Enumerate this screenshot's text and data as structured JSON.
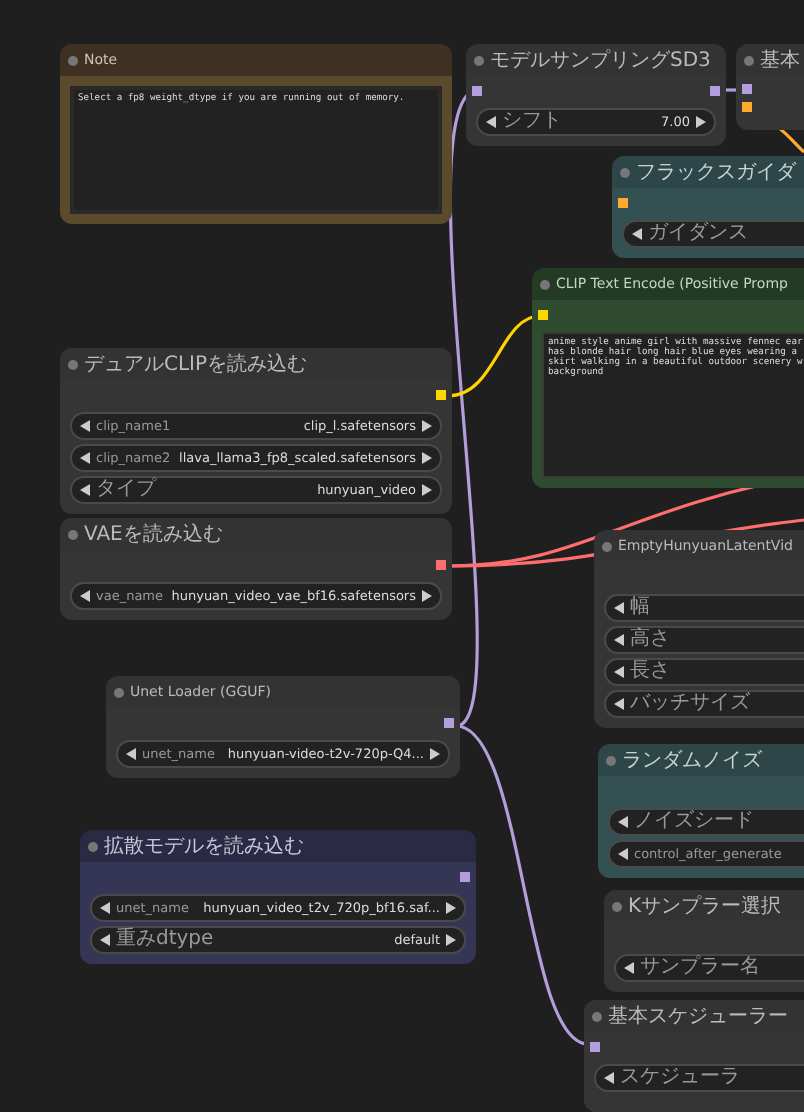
{
  "nodes": [
    {
      "title": "Note",
      "kind": "note",
      "text_lines": [
        "Select a fp8 weight_dtype if you are running out of  memory."
      ]
    },
    {
      "title": "モデルサンプリングSD3",
      "kind": "default",
      "inputs": [
        {
          "color": "#b39ddb"
        }
      ],
      "outputs": [
        {
          "color": "#b39ddb"
        }
      ],
      "widgets": [
        {
          "label": "シフト",
          "value": "7.00"
        }
      ]
    },
    {
      "title": "基本",
      "kind": "default",
      "inputs": [
        {
          "color": "#b39ddb"
        },
        {
          "color": "#ffa931"
        }
      ]
    },
    {
      "title": "フラックスガイダ",
      "kind": "teal",
      "inputs": [
        {
          "color": "#ffa931"
        }
      ],
      "widgets": [
        {
          "label": "ガイダンス"
        }
      ]
    },
    {
      "title": "CLIP Text Encode (Positive Promp",
      "kind": "green",
      "inputs": [
        {
          "color": "#ffd500"
        }
      ],
      "text_lines": [
        "anime style anime girl with massive fennec ear",
        "has blonde hair long hair blue eyes wearing a",
        "skirt walking in a beautiful outdoor scenery w",
        "background"
      ]
    },
    {
      "title": "デュアルCLIPを読み込む",
      "kind": "default",
      "outputs": [
        {
          "color": "#ffd500"
        }
      ],
      "widgets": [
        {
          "label": "clip_name1",
          "value": "clip_l.safetensors"
        },
        {
          "label": "clip_name2",
          "value": "llava_llama3_fp8_scaled.safetensors"
        },
        {
          "label": "タイプ",
          "value": "hunyuan_video"
        }
      ]
    },
    {
      "title": "VAEを読み込む",
      "kind": "default",
      "outputs": [
        {
          "color": "#ff6e6e"
        }
      ],
      "widgets": [
        {
          "label": "vae_name",
          "value": "hunyuan_video_vae_bf16.safetensors"
        }
      ]
    },
    {
      "title": "EmptyHunyuanLatentVid",
      "kind": "default",
      "widgets": [
        {
          "label": "幅"
        },
        {
          "label": "高さ"
        },
        {
          "label": "長さ"
        },
        {
          "label": "バッチサイズ"
        }
      ]
    },
    {
      "title": "Unet Loader (GGUF)",
      "kind": "default",
      "outputs": [
        {
          "color": "#b39ddb"
        }
      ],
      "widgets": [
        {
          "label": "unet_name",
          "value": "hunyuan-video-t2v-720p-Q4..."
        }
      ]
    },
    {
      "title": "ランダムノイズ",
      "kind": "teal",
      "widgets": [
        {
          "label": "ノイズシード"
        },
        {
          "label": "control_after_generate"
        }
      ]
    },
    {
      "title": "拡散モデルを読み込む",
      "kind": "purple",
      "outputs": [
        {
          "color": "#b39ddb"
        }
      ],
      "widgets": [
        {
          "label": "unet_name",
          "value": "hunyuan_video_t2v_720p_bf16.saf..."
        },
        {
          "label": "重みdtype",
          "value": "default"
        }
      ]
    },
    {
      "title": "Kサンプラー選択",
      "kind": "default",
      "widgets": [
        {
          "label": "サンプラー名"
        }
      ]
    },
    {
      "title": "基本スケジューラー",
      "kind": "default",
      "inputs": [
        {
          "color": "#b39ddb"
        }
      ],
      "widgets": [
        {
          "label": "スケジューラ"
        }
      ]
    }
  ]
}
